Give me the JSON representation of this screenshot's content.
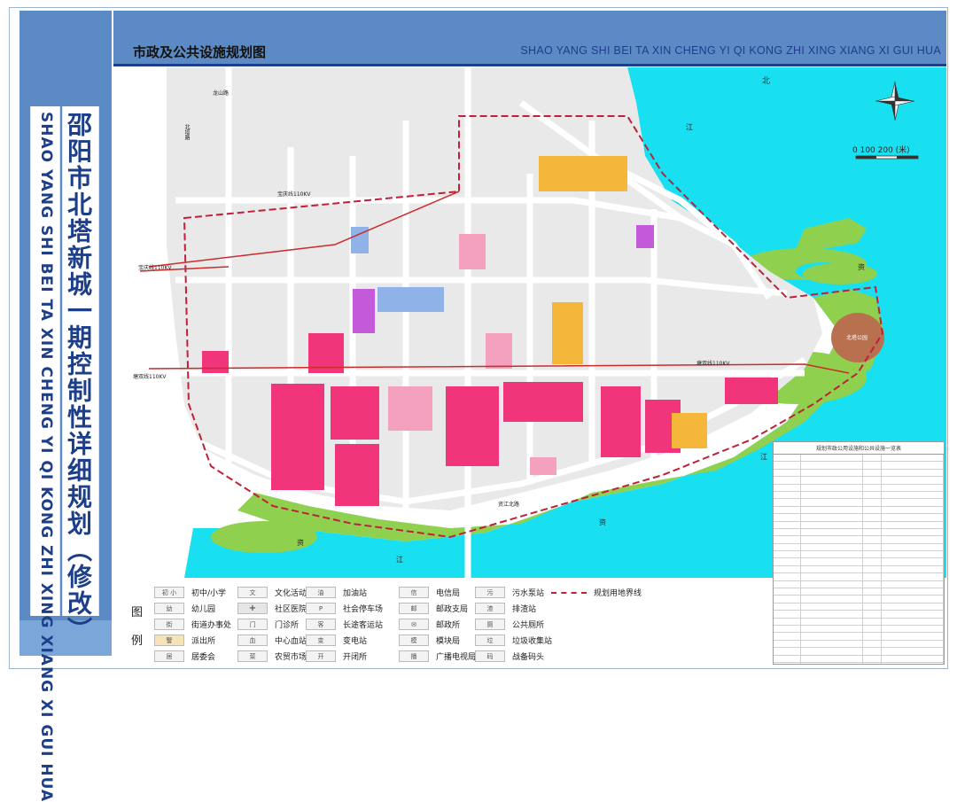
{
  "header": {
    "title": "市政及公共设施规划图",
    "pinyin": "SHAO YANG SHI BEI TA XIN CHENG YI QI KONG ZHI XING XIANG XI GUI HUA"
  },
  "sidebar": {
    "title_cn": "邵阳市北塔新城一期控制性详细规划（修改）",
    "title_pinyin": "SHAO YANG SHI BEI TA XIN CHENG YI QI KONG ZHI XING XIANG XI GUI HUA"
  },
  "map": {
    "scale_label": "0  100  200 (米)",
    "north": "北",
    "labels": {
      "jiang_1": "江",
      "jiang_2": "江",
      "jiang_3": "江",
      "zi_1": "资",
      "zi_2": "资",
      "zi_3": "资",
      "line_1": "宝庆线110KV",
      "line_2": "宝庆线110KV",
      "line_3": "塘双线110KV",
      "line_4": "塘双线110KV",
      "road_1": "北塔路",
      "road_2": "龙山路",
      "road_3": "资江北路",
      "park": "北塔公园"
    },
    "colors": {
      "water": "#19e0f0",
      "greenbelt": "#8fd14f",
      "road": "#ffffff",
      "block": "#e2e2e2",
      "school": "#f0357a",
      "admin": "#f4b73a",
      "boundary": "#c0203a"
    }
  },
  "legend": {
    "title_1": "图",
    "title_2": "例",
    "items": [
      {
        "tag": "初 小",
        "label": "初中/小学"
      },
      {
        "tag": "幼",
        "label": "幼儿园"
      },
      {
        "tag": "街",
        "label": "街道办事处"
      },
      {
        "tag": "警",
        "label": "派出所"
      },
      {
        "tag": "居",
        "label": "居委会"
      },
      {
        "tag": "文",
        "label": "文化活动中心"
      },
      {
        "tag": "+",
        "label": "社区医院"
      },
      {
        "tag": "门",
        "label": "门诊所"
      },
      {
        "tag": "血",
        "label": "中心血站"
      },
      {
        "tag": "菜",
        "label": "农贸市场"
      },
      {
        "tag": "油",
        "label": "加油站"
      },
      {
        "tag": "P",
        "label": "社会停车场"
      },
      {
        "tag": "客",
        "label": "长途客运站"
      },
      {
        "tag": "变",
        "label": "变电站"
      },
      {
        "tag": "开",
        "label": "开闭所"
      },
      {
        "tag": "信",
        "label": "电信局"
      },
      {
        "tag": "邮",
        "label": "邮政支局"
      },
      {
        "tag": "✉",
        "label": "邮政所"
      },
      {
        "tag": "模",
        "label": "模块局"
      },
      {
        "tag": "播",
        "label": "广播电视局"
      },
      {
        "tag": "污",
        "label": "污水泵站"
      },
      {
        "tag": "渣",
        "label": "排渣站"
      },
      {
        "tag": "厕",
        "label": "公共厕所"
      },
      {
        "tag": "垃",
        "label": "垃圾收集站"
      },
      {
        "tag": "码",
        "label": "战备码头"
      },
      {
        "tag": "",
        "label": "规划用地界线"
      }
    ]
  },
  "table": {
    "title": "规划市政公用设施和公共设施一览表"
  }
}
